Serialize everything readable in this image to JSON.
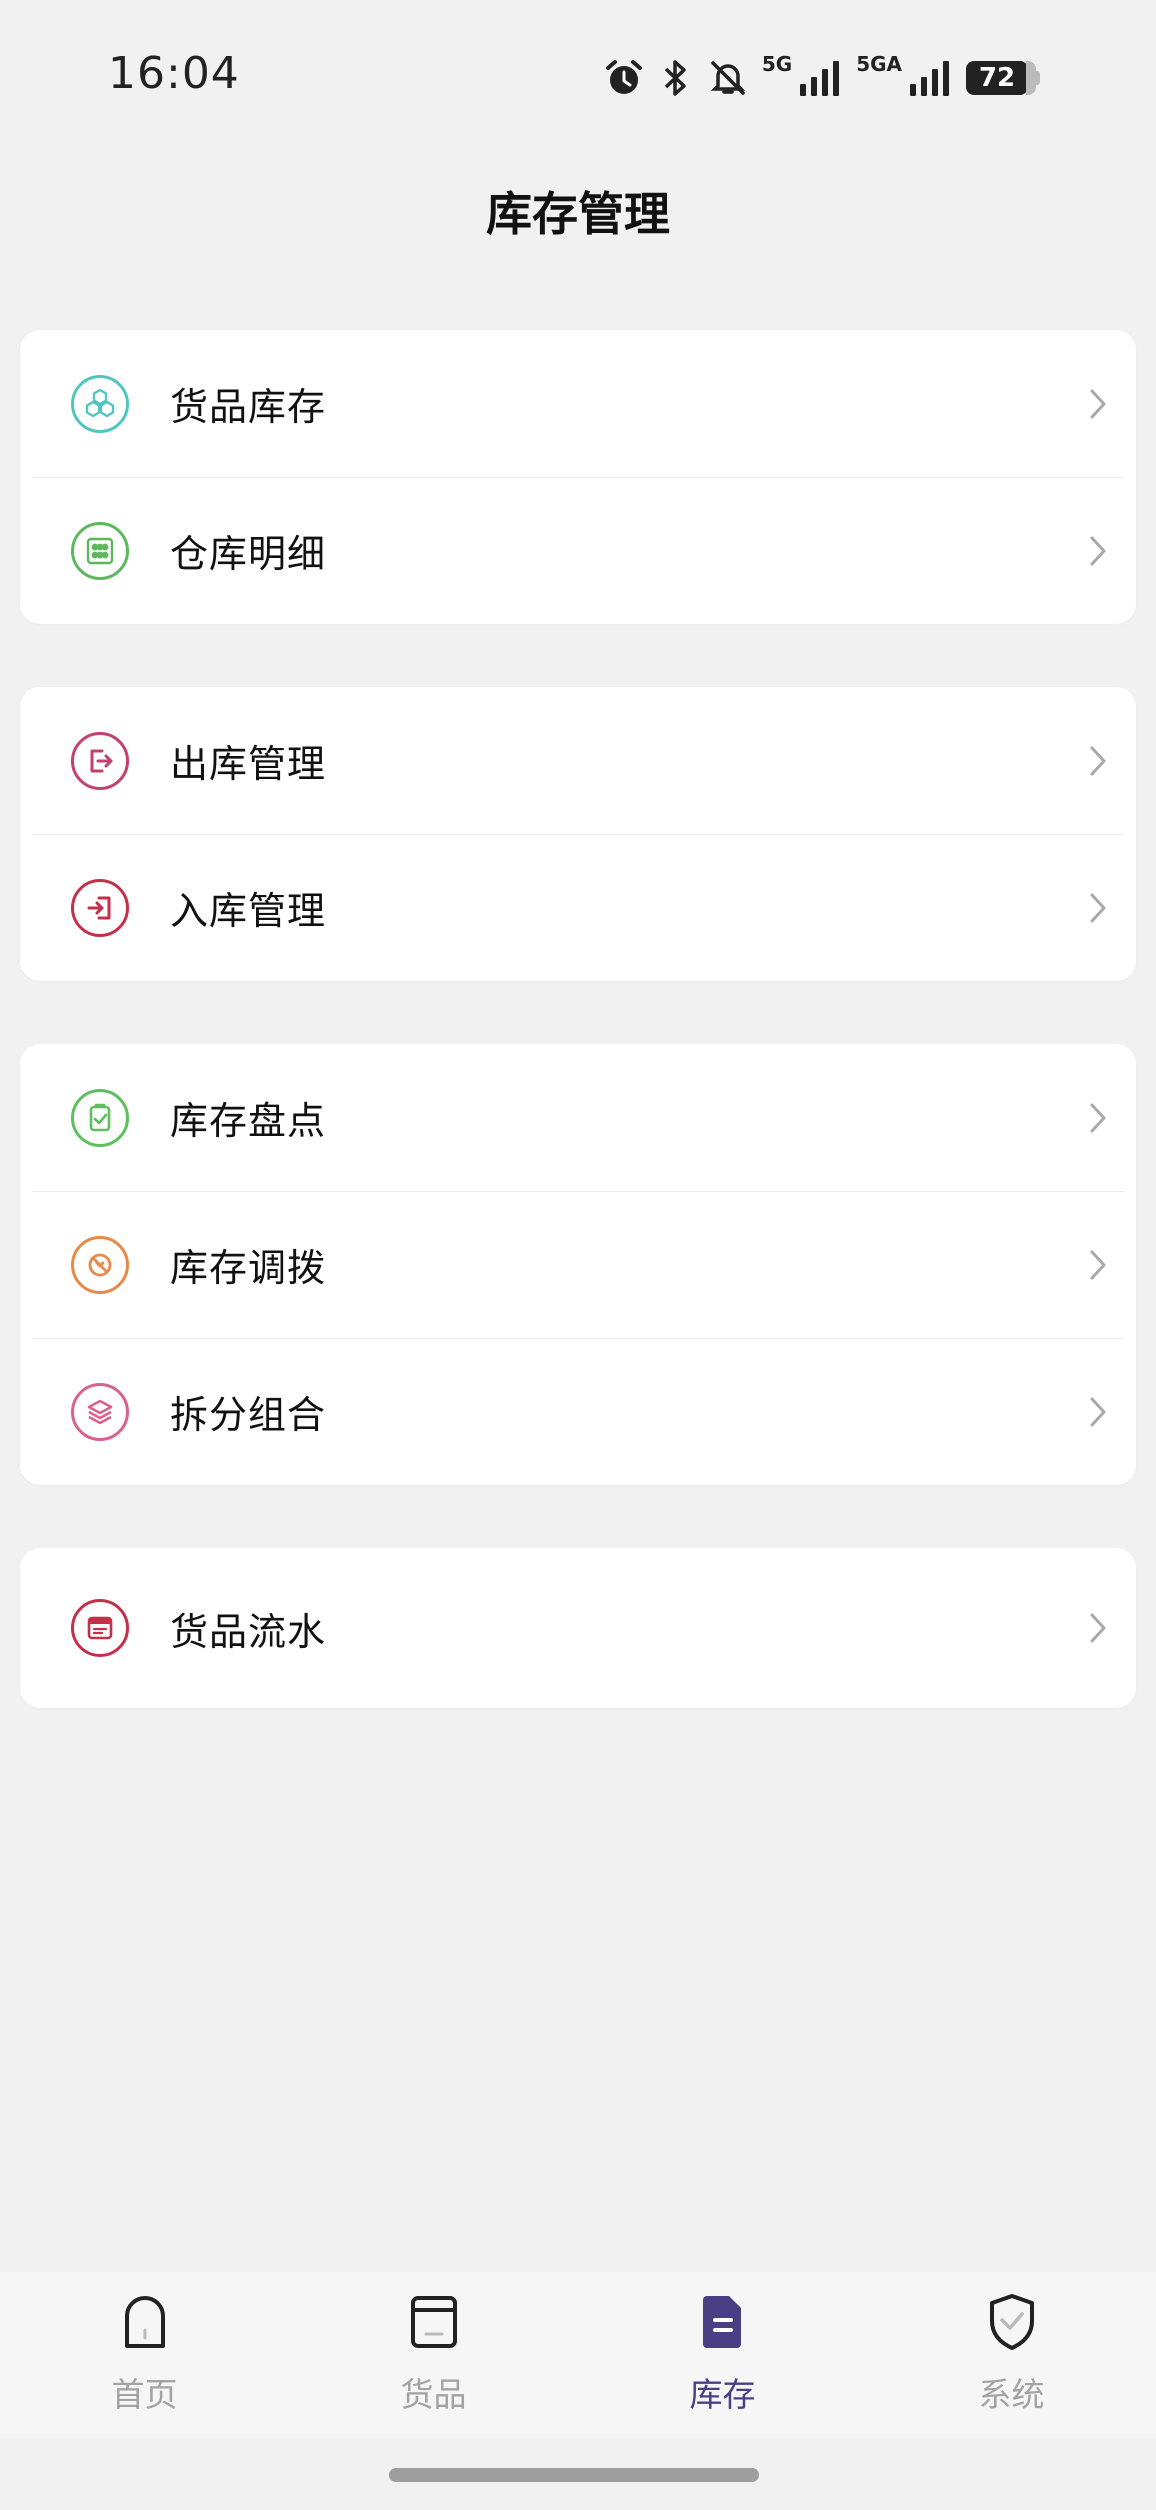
{
  "status_bar": {
    "time": "16:04",
    "net1": "5G",
    "net2": "5GA",
    "battery": "72"
  },
  "page_title": "库存管理",
  "groups": [
    {
      "items": [
        {
          "label": "货品库存",
          "icon": "boxes-icon",
          "color": "#4fc6c0"
        },
        {
          "label": "仓库明细",
          "icon": "warehouse-grid-icon",
          "color": "#5cb85c"
        }
      ]
    },
    {
      "items": [
        {
          "label": "出库管理",
          "icon": "stock-out-icon",
          "color": "#c2416f"
        },
        {
          "label": "入库管理",
          "icon": "stock-in-icon",
          "color": "#c2304a"
        }
      ]
    },
    {
      "items": [
        {
          "label": "库存盘点",
          "icon": "clipboard-check-icon",
          "color": "#5cc05c"
        },
        {
          "label": "库存调拨",
          "icon": "transfer-icon",
          "color": "#e8894a"
        },
        {
          "label": "拆分组合",
          "icon": "layers-icon",
          "color": "#d8618e"
        }
      ]
    },
    {
      "items": [
        {
          "label": "货品流水",
          "icon": "ledger-icon",
          "color": "#c2304a"
        }
      ]
    }
  ],
  "tabbar": {
    "tabs": [
      {
        "label": "首页",
        "icon": "home-icon"
      },
      {
        "label": "货品",
        "icon": "goods-icon"
      },
      {
        "label": "库存",
        "icon": "inventory-icon",
        "active": true
      },
      {
        "label": "系统",
        "icon": "system-shield-icon"
      }
    ],
    "active_color": "#4a3e85",
    "inactive_color": "#a3a3a3"
  }
}
